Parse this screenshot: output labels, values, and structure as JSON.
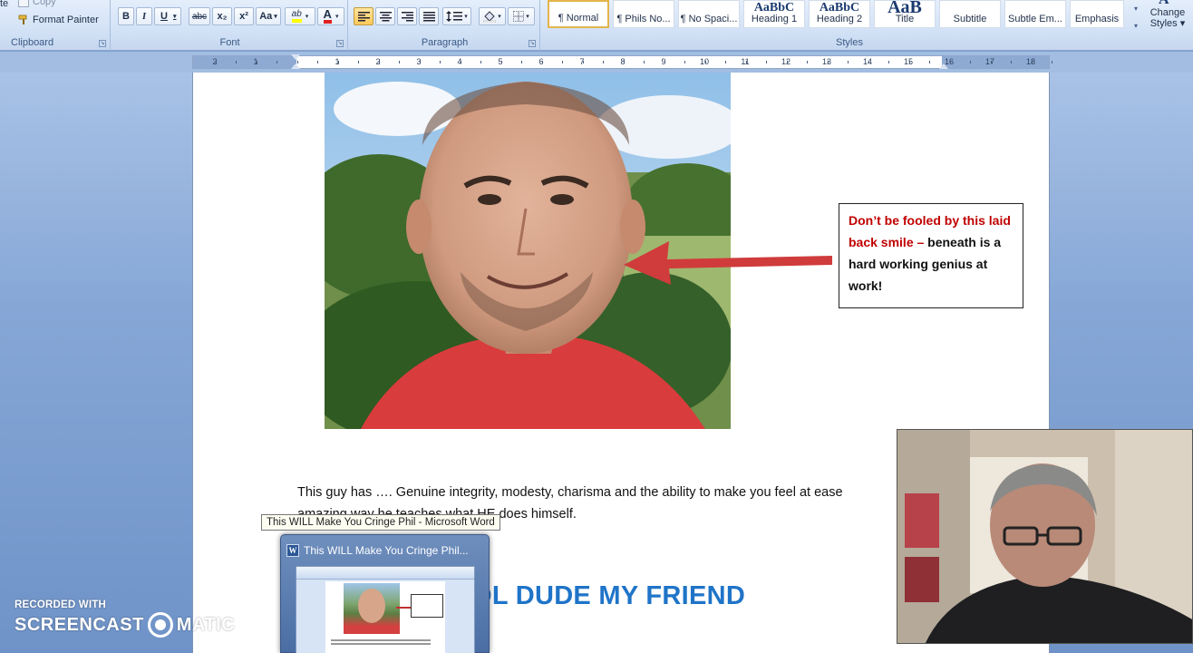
{
  "ribbon": {
    "clipboard": {
      "paste_label": "te",
      "copy_label": "Copy",
      "format_painter_label": "Format Painter",
      "group_label": "Clipboard"
    },
    "font": {
      "group_label": "Font",
      "bold": "B",
      "italic": "I",
      "underline": "U",
      "strikethrough": "abc",
      "subscript": "x₂",
      "superscript": "x²",
      "change_case": "Aa",
      "highlight": "ab",
      "font_color": "A"
    },
    "paragraph": {
      "group_label": "Paragraph"
    },
    "styles": {
      "group_label": "Styles",
      "tiles": [
        {
          "label": "¶ Normal",
          "sample": ""
        },
        {
          "label": "¶ Phils No...",
          "sample": ""
        },
        {
          "label": "¶ No Spaci...",
          "sample": ""
        },
        {
          "label": "Heading 1",
          "sample": "AaBbC"
        },
        {
          "label": "Heading 2",
          "sample": "AaBbC"
        },
        {
          "label": "Title",
          "sample": "AaB"
        },
        {
          "label": "Subtitle",
          "sample": ""
        },
        {
          "label": "Subtle Em...",
          "sample": ""
        },
        {
          "label": "Emphasis",
          "sample": ""
        }
      ],
      "change_styles_line1": "Change",
      "change_styles_line2": "Styles ▾",
      "change_styles_icon": "A"
    }
  },
  "ruler": {
    "left_numbers": [
      "2",
      "1"
    ],
    "right_numbers": [
      "1",
      "2",
      "3",
      "4",
      "5",
      "6",
      "7",
      "8",
      "9",
      "10",
      "11",
      "12",
      "13",
      "14",
      "15",
      "16",
      "17",
      "18"
    ]
  },
  "document": {
    "callout_red": "Don’t be fooled by this laid back smile –",
    "callout_black": "beneath is a hard working genius at work!",
    "body_line1": "This guy has …. Genuine integrity, modesty, charisma and the ability to make you feel at ease",
    "body_line2": "amazing way he teaches what HE does himself.",
    "heading": "OL DUDE MY FRIEND"
  },
  "taskbar_preview": {
    "tooltip": "This WILL Make You Cringe Phil - Microsoft Word",
    "title": "This WILL Make You Cringe Phil...",
    "icon_letter": "W"
  },
  "watermark": {
    "line1": "RECORDED WITH",
    "line2a": "SCREENCAST",
    "line2b": "MATIC"
  },
  "colors": {
    "callout_red": "#c00000",
    "heading_blue": "#1f74c8",
    "arrow_red": "#d03b3b"
  }
}
